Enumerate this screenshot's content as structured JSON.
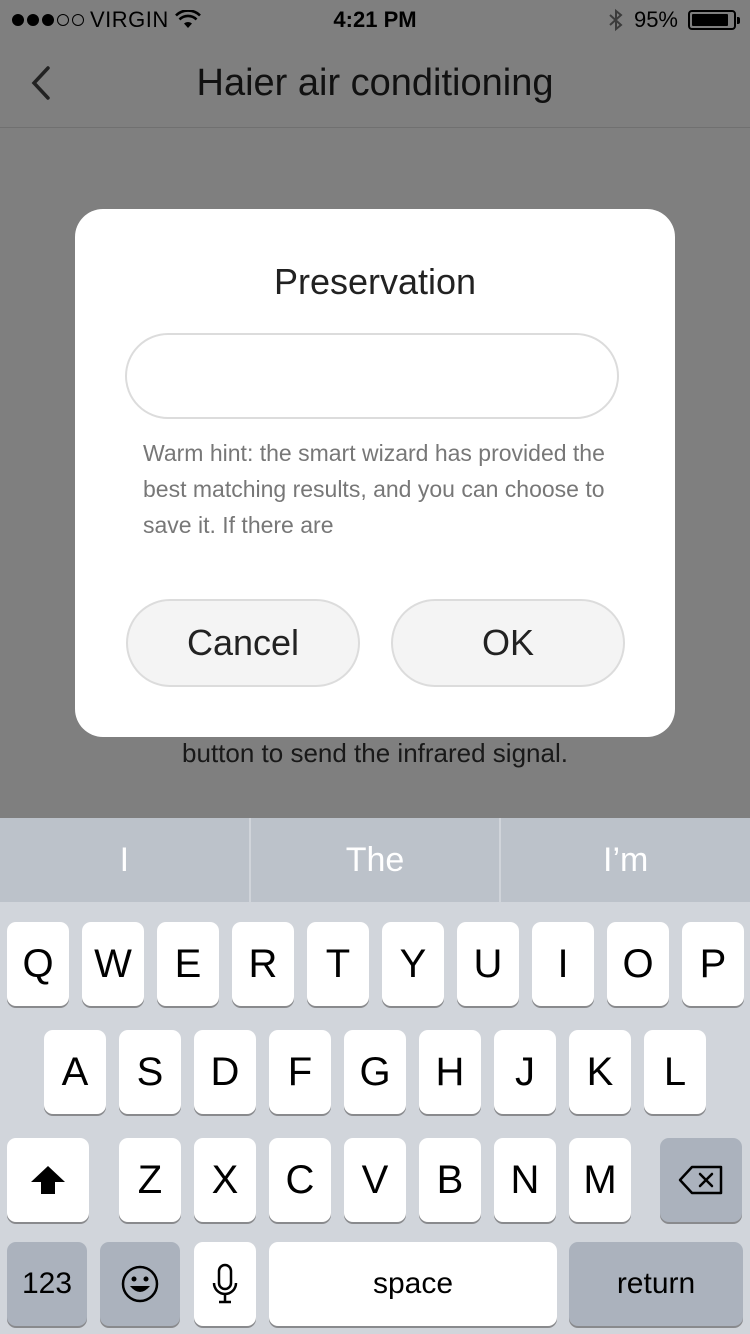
{
  "status_bar": {
    "carrier": "VIRGIN",
    "time": "4:21 PM",
    "battery": "95%",
    "signal_bars_filled": 3,
    "signal_bars_total": 5
  },
  "navbar": {
    "title": "Haier air conditioning"
  },
  "background": {
    "hint_line": "button to send the infrared signal."
  },
  "dialog": {
    "title": "Preservation",
    "input_value": "",
    "hint": "Warm hint: the smart wizard has provided the best matching results, and you can choose to save it. If there are",
    "cancel_label": "Cancel",
    "ok_label": "OK"
  },
  "keyboard": {
    "predictions": [
      "I",
      "The",
      "I’m"
    ],
    "row1": [
      "Q",
      "W",
      "E",
      "R",
      "T",
      "Y",
      "U",
      "I",
      "O",
      "P"
    ],
    "row2": [
      "A",
      "S",
      "D",
      "F",
      "G",
      "H",
      "J",
      "K",
      "L"
    ],
    "row3": [
      "Z",
      "X",
      "C",
      "V",
      "B",
      "N",
      "M"
    ],
    "numbers_label": "123",
    "space_label": "space",
    "return_label": "return"
  }
}
